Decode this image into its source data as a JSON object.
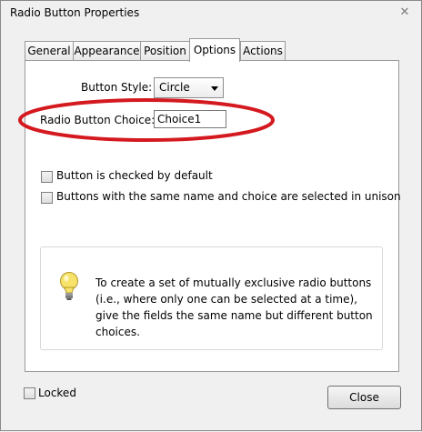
{
  "window": {
    "title": "Radio Button Properties"
  },
  "tabs": [
    {
      "label": "General"
    },
    {
      "label": "Appearance"
    },
    {
      "label": "Position"
    },
    {
      "label": "Options"
    },
    {
      "label": "Actions"
    }
  ],
  "options": {
    "button_style_label": "Button Style:",
    "button_style_value": "Circle",
    "choice_label": "Radio Button Choice:",
    "choice_value": "Choice1",
    "checked_default_label": "Button is checked by default",
    "unison_label": "Buttons with the same name and choice are selected in unison"
  },
  "info": {
    "text": "To create a set of mutually exclusive radio buttons (i.e., where only one can be selected at a time), give the fields the same name but different button choices."
  },
  "footer": {
    "locked_label": "Locked",
    "close_label": "Close"
  },
  "colors": {
    "annotation_ellipse": "#d4191f",
    "bulb": "#f7e26b"
  }
}
